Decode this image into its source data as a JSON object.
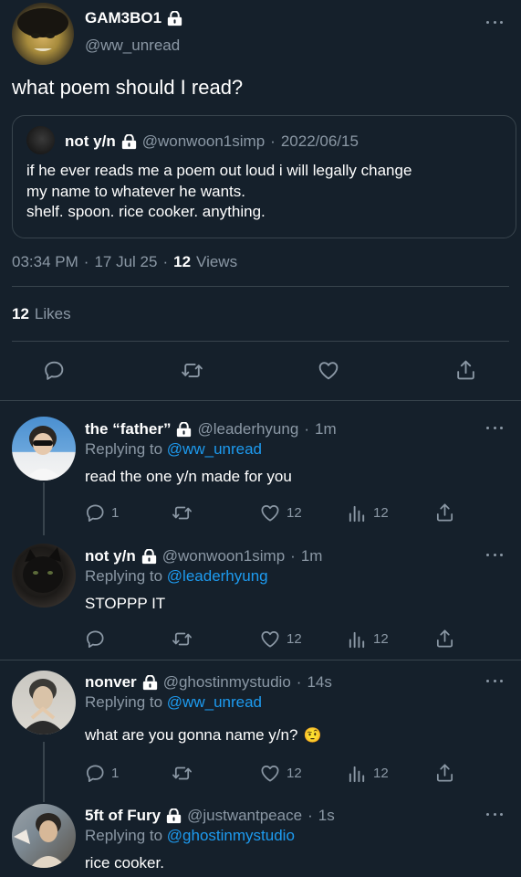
{
  "main_tweet": {
    "author": {
      "display_name": "GAM3BO1",
      "handle": "@ww_unread"
    },
    "text": "what poem should I read?",
    "quote": {
      "display_name": "not y/n",
      "handle": "@wonwoon1simp",
      "date": "2022/06/15",
      "lines": [
        "if he ever reads me a poem out loud i will legally change",
        "my name to whatever he wants.",
        "shelf. spoon. rice cooker. anything."
      ]
    },
    "meta": {
      "time": "03:34 PM",
      "date": "17 Jul 25",
      "views_count": "12",
      "views_label": "Views"
    },
    "likes": {
      "count": "12",
      "label": "Likes"
    }
  },
  "replies": [
    {
      "display_name": "the “father”",
      "handle": "@leaderhyung",
      "age": "1m",
      "replying_prefix": "Replying to",
      "replying_to": "@ww_unread",
      "text": "read the one y/n made for you",
      "reply_count": "1",
      "retweet_count": "",
      "like_count": "12",
      "view_count": "12"
    },
    {
      "display_name": "not y/n",
      "handle": "@wonwoon1simp",
      "age": "1m",
      "replying_prefix": "Replying to",
      "replying_to": "@leaderhyung",
      "text": "STOPPP IT",
      "reply_count": "",
      "retweet_count": "",
      "like_count": "12",
      "view_count": "12"
    },
    {
      "display_name": "nonver",
      "handle": "@ghostinmystudio",
      "age": "14s",
      "replying_prefix": "Replying to",
      "replying_to": "@ww_unread",
      "text": "what are you gonna name y/n?",
      "emoji": "🤨",
      "reply_count": "1",
      "retweet_count": "",
      "like_count": "12",
      "view_count": "12"
    },
    {
      "display_name": "5ft of Fury",
      "handle": "@justwantpeace",
      "age": "1s",
      "replying_prefix": "Replying to",
      "replying_to": "@ghostinmystudio",
      "text": "rice cooker."
    }
  ],
  "colors": {
    "background": "#15202b",
    "text": "#ffffff",
    "muted": "#8b98a5",
    "link": "#1d9bf0",
    "border": "#38444d"
  },
  "icons": [
    "lock-icon",
    "more-icon",
    "reply-icon",
    "retweet-icon",
    "like-icon",
    "share-icon",
    "views-icon"
  ]
}
